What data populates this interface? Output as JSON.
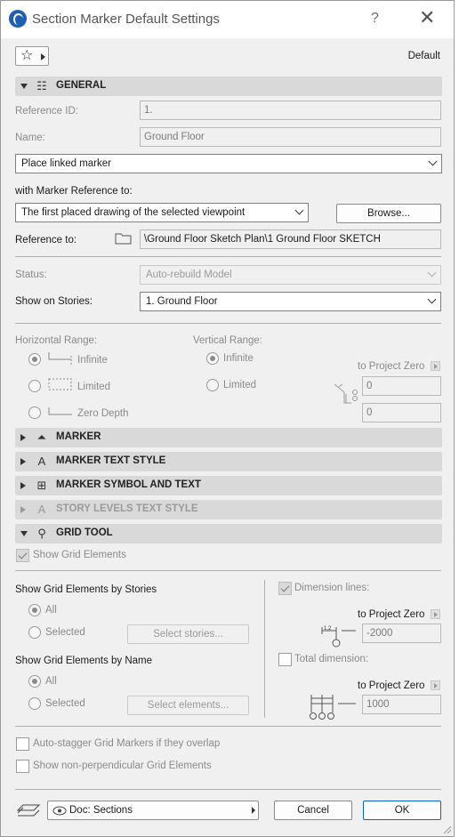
{
  "window": {
    "title": "Section Marker Default Settings",
    "help": "?",
    "close": "✕"
  },
  "favorites": {
    "label": "Default"
  },
  "general": {
    "title": "GENERAL",
    "reference_id_label": "Reference ID:",
    "reference_id_value": "1.",
    "name_label": "Name:",
    "name_value": "Ground Floor",
    "marker_mode": "Place linked marker",
    "with_marker_reference_label": "with Marker Reference to:",
    "marker_reference_value": "The first placed drawing of the selected viewpoint",
    "browse_label": "Browse...",
    "reference_to_label": "Reference to:",
    "reference_to_value": "\\Ground Floor Sketch Plan\\1 Ground Floor SKETCH",
    "status_label": "Status:",
    "status_value": "Auto-rebuild Model",
    "show_on_stories_label": "Show on Stories:",
    "show_on_stories_value": "1. Ground Floor",
    "horizontal_range_label": "Horizontal Range:",
    "horizontal_options": [
      "Infinite",
      "Limited",
      "Zero Depth"
    ],
    "vertical_range_label": "Vertical Range:",
    "vertical_options": [
      "Infinite",
      "Limited"
    ],
    "to_project_zero": "to Project Zero",
    "vertical_top": "0",
    "vertical_bottom": "0"
  },
  "sections": {
    "marker": "MARKER",
    "marker_text_style": "MARKER TEXT STYLE",
    "marker_symbol_and_text": "MARKER SYMBOL AND TEXT",
    "story_levels_text_style": "STORY LEVELS TEXT STYLE",
    "grid_tool": "GRID TOOL"
  },
  "grid_tool": {
    "show_grid_elements": "Show Grid Elements",
    "by_stories_label": "Show Grid Elements by Stories",
    "stories_options": [
      "All",
      "Selected"
    ],
    "select_stories": "Select stories...",
    "by_name_label": "Show Grid Elements by Name",
    "name_options": [
      "All",
      "Selected"
    ],
    "select_elements": "Select elements...",
    "dimension_lines": "Dimension lines:",
    "dim_to_project_zero": "to Project Zero",
    "dim_value": "-2000",
    "total_dimension": "Total dimension:",
    "total_to_project_zero": "to Project Zero",
    "total_value": "1000",
    "auto_stagger": "Auto-stagger Grid Markers if they overlap",
    "non_perpendicular": "Show non-perpendicular Grid Elements"
  },
  "footer": {
    "view_label": "Doc: Sections",
    "cancel": "Cancel",
    "ok": "OK"
  }
}
